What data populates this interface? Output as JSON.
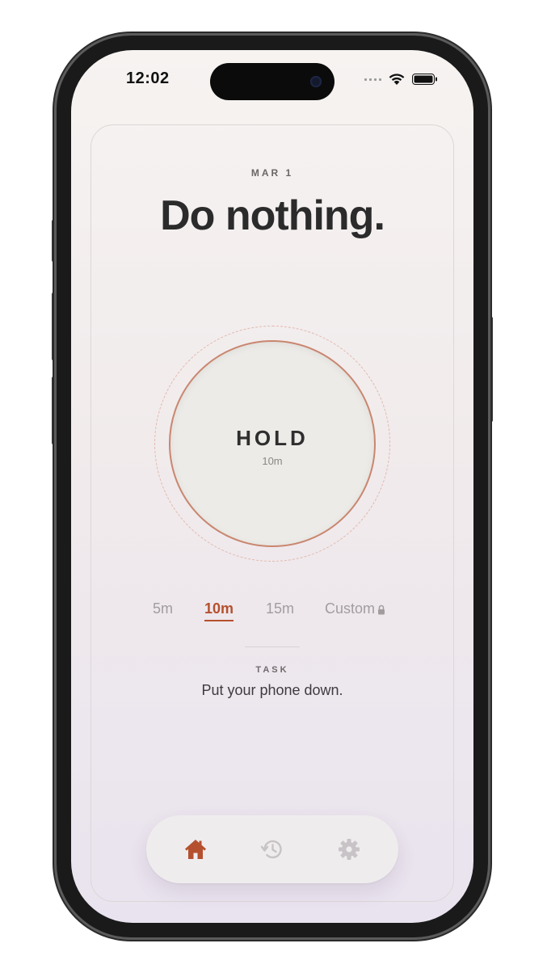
{
  "status_bar": {
    "time": "12:02"
  },
  "main": {
    "date": "MAR 1",
    "headline": "Do nothing."
  },
  "hold_button": {
    "label": "HOLD",
    "duration": "10m"
  },
  "durations": {
    "options": [
      "5m",
      "10m",
      "15m",
      "Custom"
    ],
    "selected": "10m",
    "custom_locked": true
  },
  "task": {
    "label": "TASK",
    "text": "Put your phone down."
  },
  "tab_bar": {
    "tabs": [
      {
        "icon": "home-icon",
        "active": true
      },
      {
        "icon": "history-icon",
        "active": false
      },
      {
        "icon": "gear-icon",
        "active": false
      }
    ]
  },
  "colors": {
    "accent": "#b5502e",
    "ring": "#c9866f",
    "headline": "#2b2b2b",
    "inactive": "#a19d9f"
  }
}
